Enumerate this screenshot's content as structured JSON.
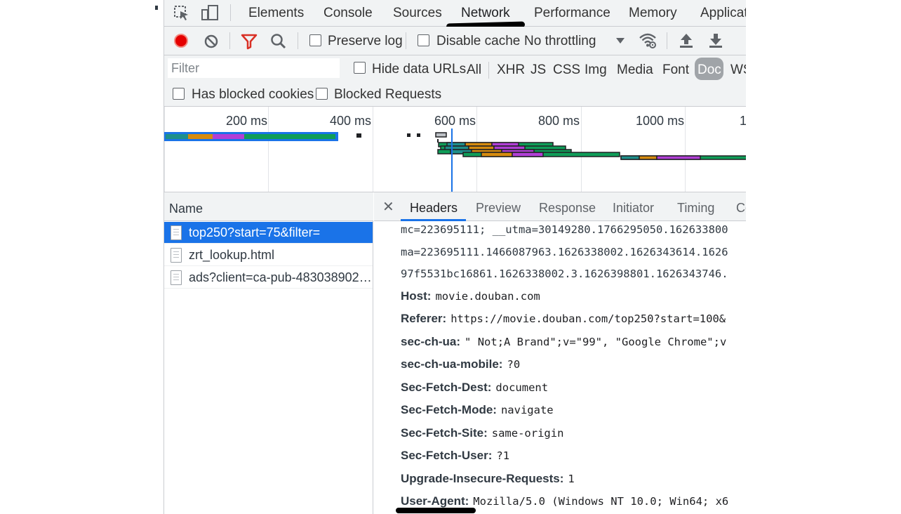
{
  "main_tabs": [
    "Elements",
    "Console",
    "Sources",
    "Network",
    "Performance",
    "Memory",
    "Applicat"
  ],
  "active_tab": "Network",
  "toolbar": {
    "preserve_log": "Preserve log",
    "disable_cache": "Disable cache",
    "throttling": "No throttling"
  },
  "filter": {
    "placeholder": "Filter",
    "hide_data_urls": "Hide data URLs",
    "types": [
      "All",
      "XHR",
      "JS",
      "CSS",
      "Img",
      "Media",
      "Font",
      "Doc",
      "WS"
    ],
    "active_type": "Doc"
  },
  "blocked": {
    "has_blocked_cookies": "Has blocked cookies",
    "blocked_requests": "Blocked Requests"
  },
  "overview": {
    "labels": [
      "200 ms",
      "400 ms",
      "600 ms",
      "800 ms",
      "1000 ms",
      "1"
    ]
  },
  "requests": {
    "header": "Name",
    "items": [
      "top250?start=75&filter=",
      "zrt_lookup.html",
      "ads?client=ca-pub-483038902…"
    ],
    "selected_index": 0
  },
  "details": {
    "close": "✕",
    "tabs": [
      "Headers",
      "Preview",
      "Response",
      "Initiator",
      "Timing",
      "Co"
    ],
    "active_tab": "Headers",
    "continuation_lines": [
      "mc=223695111; __utma=30149280.1766295050.162633800",
      "ma=223695111.1466087963.1626338002.1626343614.1626",
      "97f5531bc16861.1626338002.3.1626398801.1626343746."
    ],
    "headers": [
      {
        "key": "Host:",
        "value": "movie.douban.com"
      },
      {
        "key": "Referer:",
        "value": "https://movie.douban.com/top250?start=100&"
      },
      {
        "key": "sec-ch-ua:",
        "value": "\" Not;A Brand\";v=\"99\", \"Google Chrome\";v"
      },
      {
        "key": "sec-ch-ua-mobile:",
        "value": "?0"
      },
      {
        "key": "Sec-Fetch-Dest:",
        "value": "document"
      },
      {
        "key": "Sec-Fetch-Mode:",
        "value": "navigate"
      },
      {
        "key": "Sec-Fetch-Site:",
        "value": "same-origin"
      },
      {
        "key": "Sec-Fetch-User:",
        "value": "?1"
      },
      {
        "key": "Upgrade-Insecure-Requests:",
        "value": "1"
      },
      {
        "key": "User-Agent:",
        "value": "Mozilla/5.0 (Windows NT 10.0; Win64; x6"
      }
    ]
  },
  "colors": {
    "record": "#e50000",
    "filter_icon": "#d93025",
    "selection": "#1a73e8",
    "doc_pill": "#a0a4a8",
    "wf_teal": "#1e8f8a",
    "wf_orange": "#d68b0e",
    "wf_purple": "#b13fd6",
    "wf_green": "#0f9d58"
  }
}
